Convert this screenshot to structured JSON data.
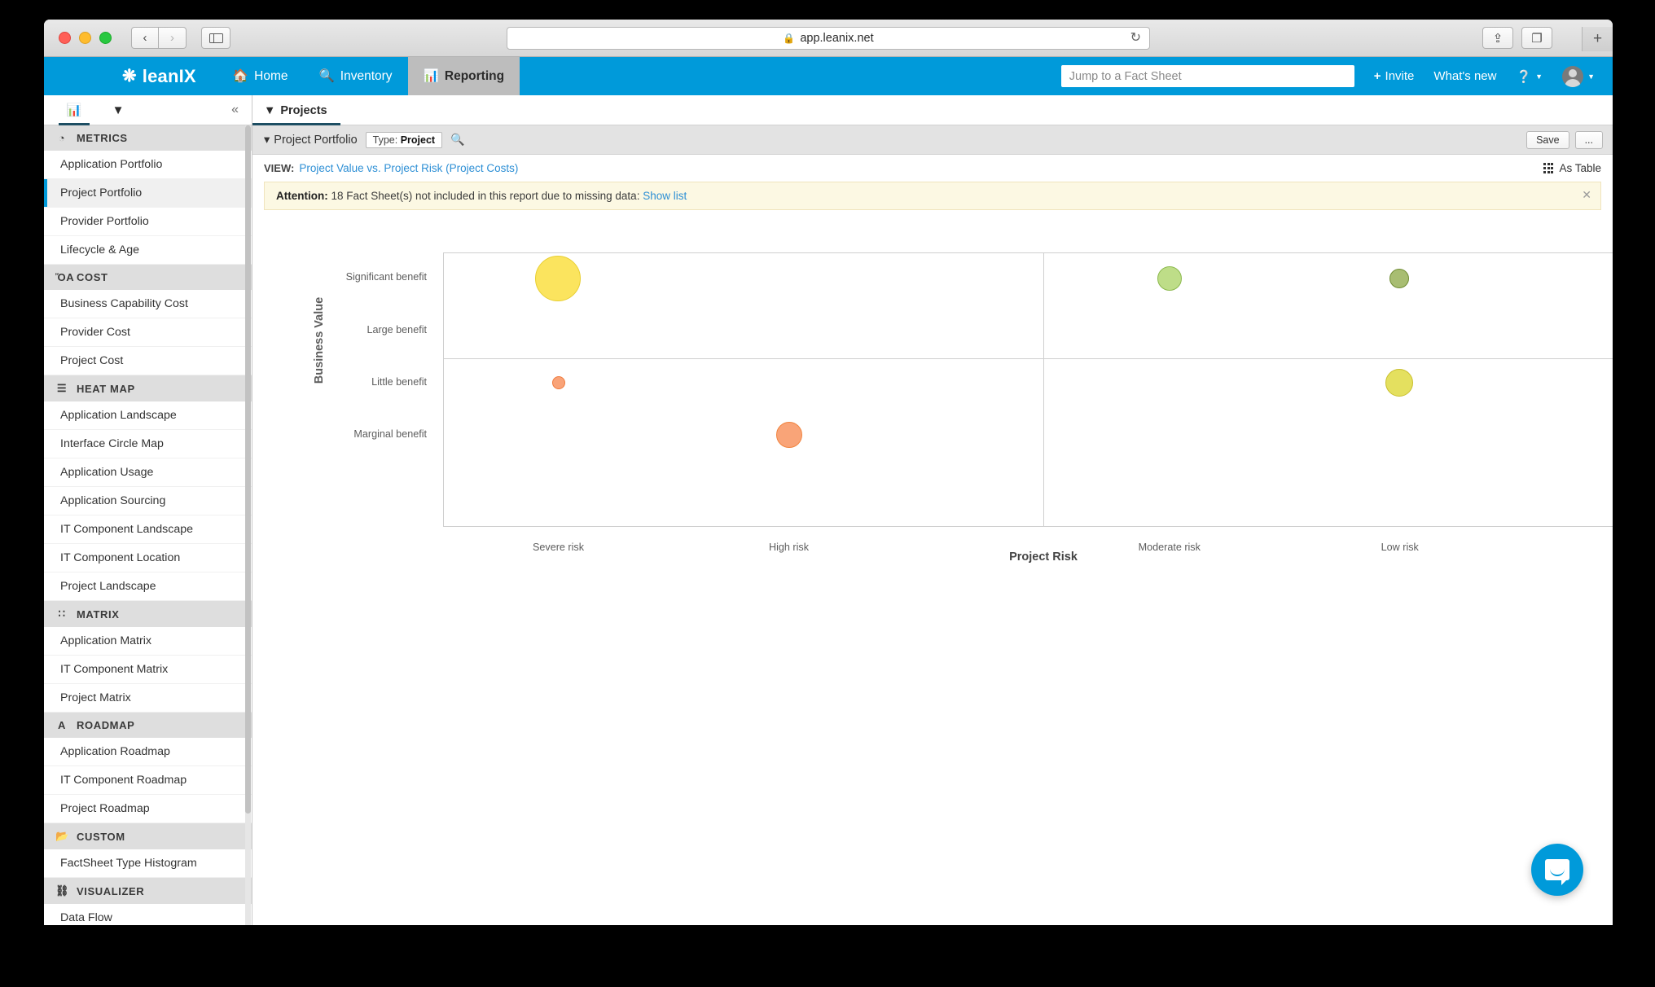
{
  "browser": {
    "url": "app.leanix.net",
    "lock_icon": "lock-icon",
    "reload_icon": "reload-icon",
    "back_icon": "chevron-left-icon",
    "forward_icon": "chevron-right-icon",
    "sidebar_icon": "sidebar-toggle-icon",
    "share_icon": "share-icon",
    "tabs_icon": "tab-overview-icon",
    "newtab_icon": "plus-icon"
  },
  "topnav": {
    "brand": "leanIX",
    "brand_logo_icon": "leanix-logo-icon",
    "items": [
      {
        "label": "Home",
        "icon": "home-icon",
        "active": false
      },
      {
        "label": "Inventory",
        "icon": "search-icon",
        "active": false
      },
      {
        "label": "Reporting",
        "icon": "bar-chart-icon",
        "active": true
      }
    ],
    "search_placeholder": "Jump to a Fact Sheet",
    "search_value": "",
    "invite_label": "Invite",
    "invite_icon": "plus-icon",
    "whats_new_label": "What's new",
    "help_icon": "help-circle-icon",
    "avatar_icon": "user-avatar-icon",
    "accent_color": "#009ada"
  },
  "sidebar": {
    "tabs": [
      {
        "icon": "bar-chart-icon",
        "name": "reports-tab",
        "active": true
      },
      {
        "icon": "filter-icon",
        "name": "filter-tab",
        "active": false
      }
    ],
    "collapse_icon": "chevron-double-left-icon",
    "groups": [
      {
        "title": "METRICS",
        "icon": "gauge-icon",
        "items": [
          {
            "label": "Application Portfolio",
            "selected": false
          },
          {
            "label": "Project Portfolio",
            "selected": true
          },
          {
            "label": "Provider Portfolio",
            "selected": false
          },
          {
            "label": "Lifecycle & Age",
            "selected": false
          }
        ]
      },
      {
        "title": "COST",
        "icon": "bar-chart-icon",
        "items": [
          {
            "label": "Business Capability Cost",
            "selected": false
          },
          {
            "label": "Provider Cost",
            "selected": false
          },
          {
            "label": "Project Cost",
            "selected": false
          }
        ]
      },
      {
        "title": "HEAT MAP",
        "icon": "heatmap-icon",
        "items": [
          {
            "label": "Application Landscape",
            "selected": false
          },
          {
            "label": "Interface Circle Map",
            "selected": false
          },
          {
            "label": "Application Usage",
            "selected": false
          },
          {
            "label": "Application Sourcing",
            "selected": false
          },
          {
            "label": "IT Component Landscape",
            "selected": false
          },
          {
            "label": "IT Component Location",
            "selected": false
          },
          {
            "label": "Project Landscape",
            "selected": false
          }
        ]
      },
      {
        "title": "MATRIX",
        "icon": "grid-icon",
        "items": [
          {
            "label": "Application Matrix",
            "selected": false
          },
          {
            "label": "IT Component Matrix",
            "selected": false
          },
          {
            "label": "Project Matrix",
            "selected": false
          }
        ]
      },
      {
        "title": "ROADMAP",
        "icon": "roadmap-icon",
        "items": [
          {
            "label": "Application Roadmap",
            "selected": false
          },
          {
            "label": "IT Component Roadmap",
            "selected": false
          },
          {
            "label": "Project Roadmap",
            "selected": false
          }
        ]
      },
      {
        "title": "CUSTOM",
        "icon": "folder-open-icon",
        "items": [
          {
            "label": "FactSheet Type Histogram",
            "selected": false
          }
        ]
      },
      {
        "title": "VISUALIZER",
        "icon": "sitemap-icon",
        "items": [
          {
            "label": "Data Flow",
            "selected": false
          }
        ]
      }
    ]
  },
  "main": {
    "tab": {
      "label": "Projects",
      "icon": "filter-icon"
    },
    "breadcrumb": {
      "caret_icon": "caret-down-icon",
      "label": "Project Portfolio",
      "chip_prefix": "Type:",
      "chip_value": "Project",
      "search_icon": "search-icon"
    },
    "toolbar": {
      "save_label": "Save",
      "more_label": "..."
    },
    "view": {
      "prefix": "VIEW:",
      "name": "Project Value vs. Project Risk (Project Costs)",
      "as_table_label": "As Table",
      "as_table_icon": "grid-icon"
    },
    "alert": {
      "strong": "Attention:",
      "text": " 18 Fact Sheet(s) not included in this report due to missing data: ",
      "link": "Show list",
      "close_icon": "close-icon",
      "bg_color": "#fcf8e3"
    },
    "chat_icon": "chat-bubble-icon"
  },
  "chart_data": {
    "type": "scatter",
    "title": "Project Value vs. Project Risk (Project Costs)",
    "xlabel": "Project Risk",
    "ylabel": "Business Value",
    "grid": true,
    "x_categories": [
      "Severe risk",
      "High risk",
      "Moderate risk",
      "Low risk"
    ],
    "y_categories": [
      "Significant benefit",
      "Large benefit",
      "Little benefit",
      "Marginal benefit"
    ],
    "quadrant_split_x": 0.5,
    "quadrant_split_y": 0.385,
    "points": [
      {
        "x": "Severe risk",
        "y": "Significant benefit",
        "x_frac": 0.095,
        "y_frac": 0.093,
        "radius": 28,
        "color": "#fbe45e",
        "stroke": "#e8cf33",
        "size_label": "largest"
      },
      {
        "x": "Moderate risk",
        "y": "Significant benefit",
        "x_frac": 0.605,
        "y_frac": 0.093,
        "radius": 15,
        "color": "#bedd88",
        "stroke": "#8cb94e",
        "size_label": "medium"
      },
      {
        "x": "Low risk",
        "y": "Significant benefit",
        "x_frac": 0.797,
        "y_frac": 0.093,
        "radius": 12,
        "color": "#a8bd72",
        "stroke": "#6f8c32",
        "size_label": "small"
      },
      {
        "x": "Severe risk",
        "y": "Little benefit",
        "x_frac": 0.096,
        "y_frac": 0.475,
        "radius": 8,
        "color": "#f9a378",
        "stroke": "#f07a3c",
        "size_label": "smallest"
      },
      {
        "x": "Low risk",
        "y": "Little benefit",
        "x_frac": 0.797,
        "y_frac": 0.475,
        "radius": 17,
        "color": "#e4e05f",
        "stroke": "#c9bf2c",
        "size_label": "medium"
      },
      {
        "x": "High risk",
        "y": "Marginal benefit",
        "x_frac": 0.288,
        "y_frac": 0.665,
        "radius": 16,
        "color": "#f9a478",
        "stroke": "#f1843f",
        "size_label": "medium"
      }
    ]
  }
}
